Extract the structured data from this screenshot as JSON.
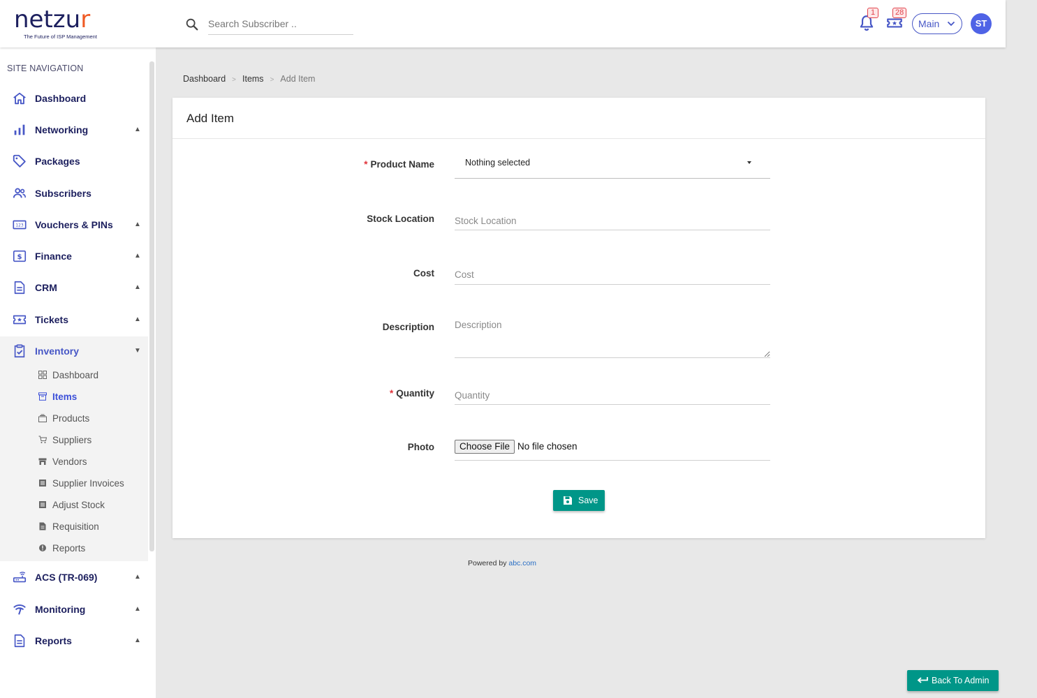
{
  "brand": {
    "name_part1": "netzu",
    "name_part2": "r",
    "tagline": "The Future of ISP Management"
  },
  "header": {
    "search_placeholder": "Search Subscriber ..",
    "notifications_count": "1",
    "tickets_count": "28",
    "workspace": "Main",
    "avatar_initials": "ST",
    "accent_color": "#4757c6"
  },
  "sidebar": {
    "title": "SITE NAVIGATION",
    "items": [
      {
        "label": "Dashboard",
        "icon": "home-icon",
        "caret": ""
      },
      {
        "label": "Networking",
        "icon": "bar-chart-icon",
        "caret": "▲"
      },
      {
        "label": "Packages",
        "icon": "tag-icon",
        "caret": ""
      },
      {
        "label": "Subscribers",
        "icon": "users-icon",
        "caret": ""
      },
      {
        "label": "Vouchers & PINs",
        "icon": "voucher-123-icon",
        "caret": "▲"
      },
      {
        "label": "Finance",
        "icon": "dollar-icon",
        "caret": "▲"
      },
      {
        "label": "CRM",
        "icon": "document-icon",
        "caret": "▲"
      },
      {
        "label": "Tickets",
        "icon": "ticket-star-icon",
        "caret": "▲"
      },
      {
        "label": "Inventory",
        "icon": "clipboard-check-icon",
        "caret": "▼"
      },
      {
        "label": "ACS (TR-069)",
        "icon": "router-icon",
        "caret": "▲"
      },
      {
        "label": "Monitoring",
        "icon": "signal-icon",
        "caret": "▲"
      },
      {
        "label": "Reports",
        "icon": "report-icon",
        "caret": "▲"
      }
    ],
    "inventory_sub": [
      {
        "label": "Dashboard",
        "icon": "grid-icon"
      },
      {
        "label": "Items",
        "icon": "archive-icon"
      },
      {
        "label": "Products",
        "icon": "stack-icon"
      },
      {
        "label": "Suppliers",
        "icon": "cart-icon"
      },
      {
        "label": "Vendors",
        "icon": "store-icon"
      },
      {
        "label": "Supplier Invoices",
        "icon": "list-icon"
      },
      {
        "label": "Adjust Stock",
        "icon": "list-icon"
      },
      {
        "label": "Requisition",
        "icon": "file-icon"
      },
      {
        "label": "Reports",
        "icon": "info-circle-icon"
      }
    ],
    "active_sub": "Items"
  },
  "breadcrumb": [
    "Dashboard",
    "Items",
    "Add Item"
  ],
  "form": {
    "title": "Add Item",
    "product_name": {
      "label": "Product Name",
      "value": "Nothing selected",
      "required": true
    },
    "stock_location": {
      "label": "Stock Location",
      "placeholder": "Stock Location"
    },
    "cost": {
      "label": "Cost",
      "placeholder": "Cost"
    },
    "description": {
      "label": "Description",
      "placeholder": "Description"
    },
    "quantity": {
      "label": "Quantity",
      "placeholder": "Quantity",
      "required": true
    },
    "photo": {
      "label": "Photo",
      "button": "Choose File",
      "status": "No file chosen"
    },
    "save_label": "Save",
    "button_color": "#009688"
  },
  "footer": {
    "powered_by": "Powered by",
    "link": "abc.com"
  },
  "back_to_admin": "Back To Admin"
}
